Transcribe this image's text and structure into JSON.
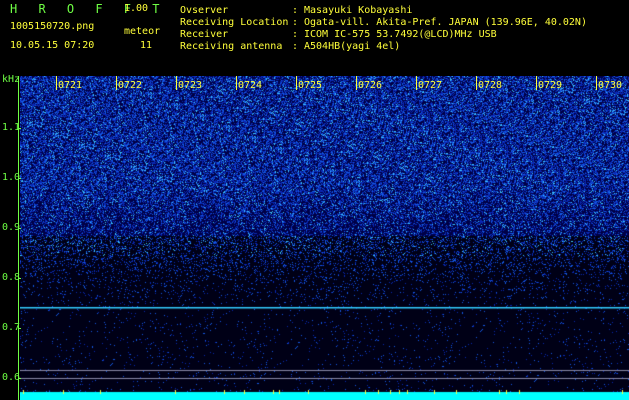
{
  "app": {
    "title": "H R O F F T",
    "version": "1.00"
  },
  "file": {
    "name": "1005150720.png",
    "datetime": "10.05.15 07:20"
  },
  "meteor": {
    "label": "meteor",
    "count": "11"
  },
  "info": [
    {
      "label": "Ovserver",
      "value": "Masayuki Kobayashi"
    },
    {
      "label": "Receiving Location",
      "value": "Ogata-vill. Akita-Pref. JAPAN (139.96E, 40.02N)"
    },
    {
      "label": "Receiver",
      "value": "ICOM IC-575 53.7492(@LCD)MHz USB"
    },
    {
      "label": "Receiving antenna",
      "value": "A504HB(yagi 4el)"
    }
  ],
  "colon": ":",
  "axis": {
    "unit": "kHz",
    "ticks": [
      "1.1",
      "1.0",
      "0.9",
      "0.8",
      "0.7",
      "0.6"
    ],
    "times": [
      "0721",
      "0722",
      "0723",
      "0724",
      "0725",
      "0726",
      "0727",
      "0728",
      "0729",
      "0730"
    ]
  },
  "colors": {
    "text_green": "#6fff44",
    "text_yellow": "#ffff3a",
    "signal_line": "#33ccff",
    "floor": "#00ffff"
  }
}
